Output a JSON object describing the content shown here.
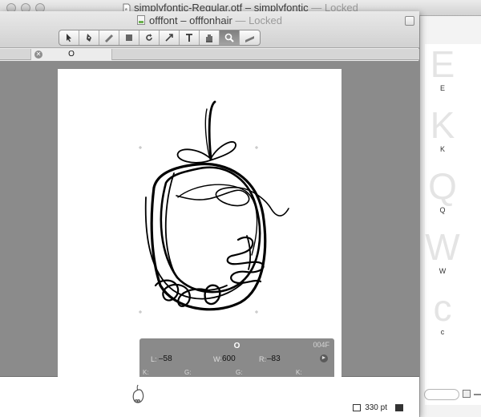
{
  "back_window": {
    "title": "simplyfontic-Regular.otf – simplyfontic",
    "locked": "— Locked",
    "glyph_list": [
      {
        "big": "E",
        "small": "E"
      },
      {
        "big": "K",
        "small": "K"
      },
      {
        "big": "Q",
        "small": "Q"
      },
      {
        "big": "W",
        "small": "W"
      },
      {
        "big": "c",
        "small": "c"
      }
    ]
  },
  "front_window": {
    "title": "offfont – offfonhair",
    "locked": "— Locked",
    "toolbar": [
      "pointer-tool",
      "pen-tool",
      "knife-tool",
      "rectangle-tool",
      "rotate-tool",
      "scale-tool",
      "text-tool",
      "hand-tool",
      "zoom-tool",
      "ruler-tool"
    ],
    "active_tool": "zoom-tool",
    "tab_label": "O",
    "info_panel": {
      "glyph_name": "O",
      "unicode": "004F",
      "left_label": "L:",
      "left_value": "–58",
      "width_label": "W:",
      "width_value": "600",
      "right_label": "R:",
      "right_value": "–83",
      "k1": "K:",
      "g1": "G:",
      "g2": "G:",
      "k2": "K:"
    },
    "zoom_label": "330 pt"
  }
}
